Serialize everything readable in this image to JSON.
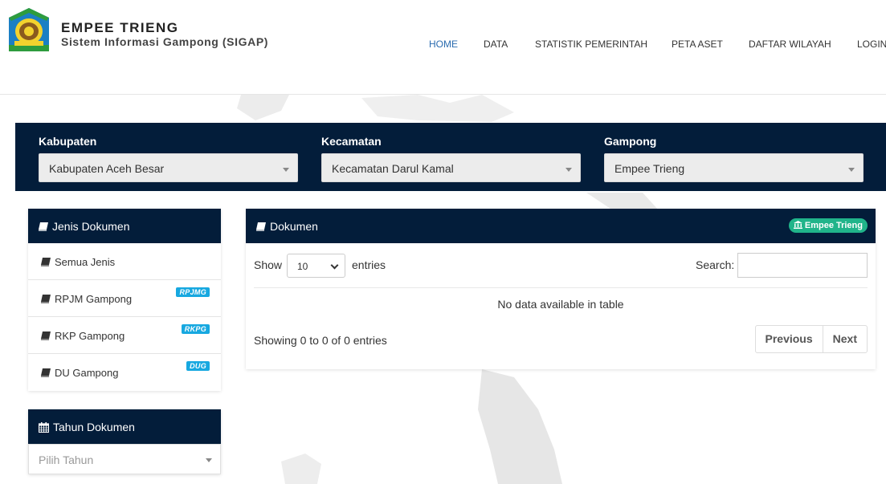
{
  "brand": {
    "title": "EMPEE TRIENG",
    "subtitle": "Sistem Informasi Gampong (SIGAP)"
  },
  "nav": [
    {
      "label": "HOME",
      "active": true
    },
    {
      "label": "DATA"
    },
    {
      "label": "STATISTIK PEMERINTAH"
    },
    {
      "label": "PETA ASET"
    },
    {
      "label": "DAFTAR WILAYAH"
    },
    {
      "label": "LOGIN"
    }
  ],
  "filters": {
    "kabupaten": {
      "label": "Kabupaten",
      "value": "Kabupaten Aceh Besar"
    },
    "kecamatan": {
      "label": "Kecamatan",
      "value": "Kecamatan Darul Kamal"
    },
    "gampong": {
      "label": "Gampong",
      "value": "Empee Trieng"
    }
  },
  "jenis_panel": {
    "title": "Jenis Dokumen",
    "items": [
      {
        "label": "Semua Jenis",
        "badge": ""
      },
      {
        "label": "RPJM Gampong",
        "badge": "RPJMG"
      },
      {
        "label": "RKP Gampong",
        "badge": "RKPG"
      },
      {
        "label": "DU Gampong",
        "badge": "DUG"
      }
    ]
  },
  "tahun_panel": {
    "title": "Tahun Dokumen",
    "placeholder": "Pilih Tahun"
  },
  "dokumen_panel": {
    "title": "Dokumen",
    "badge": "Empee Trieng",
    "show_label": "Show",
    "entries_value": "10",
    "entries_label": "entries",
    "search_label": "Search:",
    "empty_message": "No data available in table",
    "info": "Showing 0 to 0 of 0 entries",
    "prev": "Previous",
    "next": "Next"
  },
  "colors": {
    "navy": "#031d3a",
    "badge_blue": "#17a8e0",
    "badge_green": "#20b48a",
    "active_nav": "#2b6cb0"
  }
}
